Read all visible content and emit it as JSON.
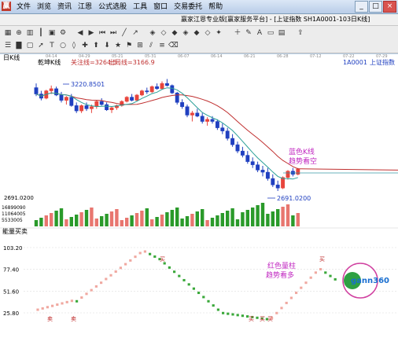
{
  "window": {
    "app_title": "赢家江恩专业版[赢家服务平台] - [上证指数  SH1A0001-103日K线]",
    "menu": [
      "文件",
      "浏览",
      "资讯",
      "江恩",
      "公式选股",
      "工具",
      "窗口",
      "交易委托",
      "帮助"
    ],
    "controls": [
      "_",
      "□",
      "×"
    ]
  },
  "panel": {
    "period_label": "日K线",
    "indicator_name": "乾坤K线",
    "legend_attention": "关注线=3264.5",
    "legend_exit": "出局线=3166.9",
    "code": "1A0001",
    "index_name": "上证指数",
    "volume_label": "能量买卖"
  },
  "annotations": {
    "high_price": "3220.8501",
    "low_price": "2691.0200",
    "blue_note": [
      "蓝色K线",
      "趋势看空"
    ],
    "red_note": [
      "红色量柱",
      "趋势看多"
    ],
    "buy_mark": "买",
    "sell_mark": "卖"
  },
  "axis": {
    "price_left": "2691.0200",
    "volume_ticks": [
      "16899090",
      "11064005",
      "5533005"
    ],
    "osc_ticks": [
      "103.20",
      "77.40",
      "51.60",
      "25.80"
    ],
    "date_ticks": [
      "04-14",
      "04-29",
      "05-21",
      "05-31",
      "06-07",
      "06-14",
      "06-21",
      "06-28",
      "07-12",
      "07-22",
      "07-29"
    ]
  },
  "watermark": {
    "brand": "gann360"
  },
  "colors": {
    "up": "#e8453c",
    "down": "#2040c0",
    "ma1": "#c03030",
    "ma2": "#2aa098",
    "vol_up": "#e8766f",
    "vol_down": "#2a9a2a"
  },
  "chart_data": {
    "type": "candlestick",
    "note": "approximate daily candles: open, high, low, close",
    "candles": [
      [
        3180,
        3200,
        3140,
        3150
      ],
      [
        3150,
        3165,
        3120,
        3130
      ],
      [
        3130,
        3170,
        3125,
        3165
      ],
      [
        3165,
        3190,
        3150,
        3175
      ],
      [
        3175,
        3185,
        3140,
        3145
      ],
      [
        3145,
        3160,
        3110,
        3120
      ],
      [
        3120,
        3140,
        3100,
        3135
      ],
      [
        3135,
        3150,
        3090,
        3095
      ],
      [
        3095,
        3110,
        3060,
        3070
      ],
      [
        3070,
        3100,
        3060,
        3095
      ],
      [
        3095,
        3110,
        3070,
        3080
      ],
      [
        3080,
        3100,
        3060,
        3090
      ],
      [
        3090,
        3120,
        3080,
        3115
      ],
      [
        3115,
        3130,
        3095,
        3100
      ],
      [
        3100,
        3110,
        3070,
        3075
      ],
      [
        3075,
        3090,
        3060,
        3085
      ],
      [
        3085,
        3100,
        3075,
        3095
      ],
      [
        3095,
        3120,
        3090,
        3115
      ],
      [
        3115,
        3140,
        3110,
        3135
      ],
      [
        3135,
        3150,
        3115,
        3120
      ],
      [
        3120,
        3150,
        3115,
        3145
      ],
      [
        3145,
        3170,
        3140,
        3165
      ],
      [
        3165,
        3180,
        3150,
        3160
      ],
      [
        3160,
        3190,
        3155,
        3185
      ],
      [
        3185,
        3200,
        3170,
        3175
      ],
      [
        3175,
        3210,
        3170,
        3200
      ],
      [
        3200,
        3221,
        3185,
        3190
      ],
      [
        3190,
        3195,
        3150,
        3155
      ],
      [
        3155,
        3160,
        3100,
        3110
      ],
      [
        3110,
        3125,
        3080,
        3090
      ],
      [
        3090,
        3100,
        3040,
        3050
      ],
      [
        3050,
        3070,
        3020,
        3060
      ],
      [
        3060,
        3080,
        3040,
        3045
      ],
      [
        3045,
        3060,
        3010,
        3020
      ],
      [
        3020,
        3040,
        3000,
        3030
      ],
      [
        3030,
        3045,
        3010,
        3020
      ],
      [
        3020,
        3030,
        2980,
        2990
      ],
      [
        2990,
        3010,
        2960,
        2975
      ],
      [
        2975,
        2990,
        2930,
        2940
      ],
      [
        2940,
        2960,
        2900,
        2910
      ],
      [
        2910,
        2925,
        2870,
        2880
      ],
      [
        2880,
        2900,
        2850,
        2860
      ],
      [
        2860,
        2880,
        2820,
        2830
      ],
      [
        2830,
        2850,
        2800,
        2815
      ],
      [
        2815,
        2830,
        2780,
        2790
      ],
      [
        2790,
        2810,
        2760,
        2780
      ],
      [
        2780,
        2800,
        2740,
        2750
      ],
      [
        2750,
        2770,
        2710,
        2720
      ],
      [
        2720,
        2740,
        2691,
        2705
      ],
      [
        2705,
        2760,
        2700,
        2755
      ],
      [
        2755,
        2790,
        2745,
        2785
      ],
      [
        2785,
        2800,
        2760,
        2770
      ],
      [
        2770,
        2800,
        2765,
        2795
      ]
    ],
    "volume_ticks": [
      16899090,
      11064005,
      5533005
    ],
    "oscillator_range": [
      25.8,
      103.2
    ]
  }
}
